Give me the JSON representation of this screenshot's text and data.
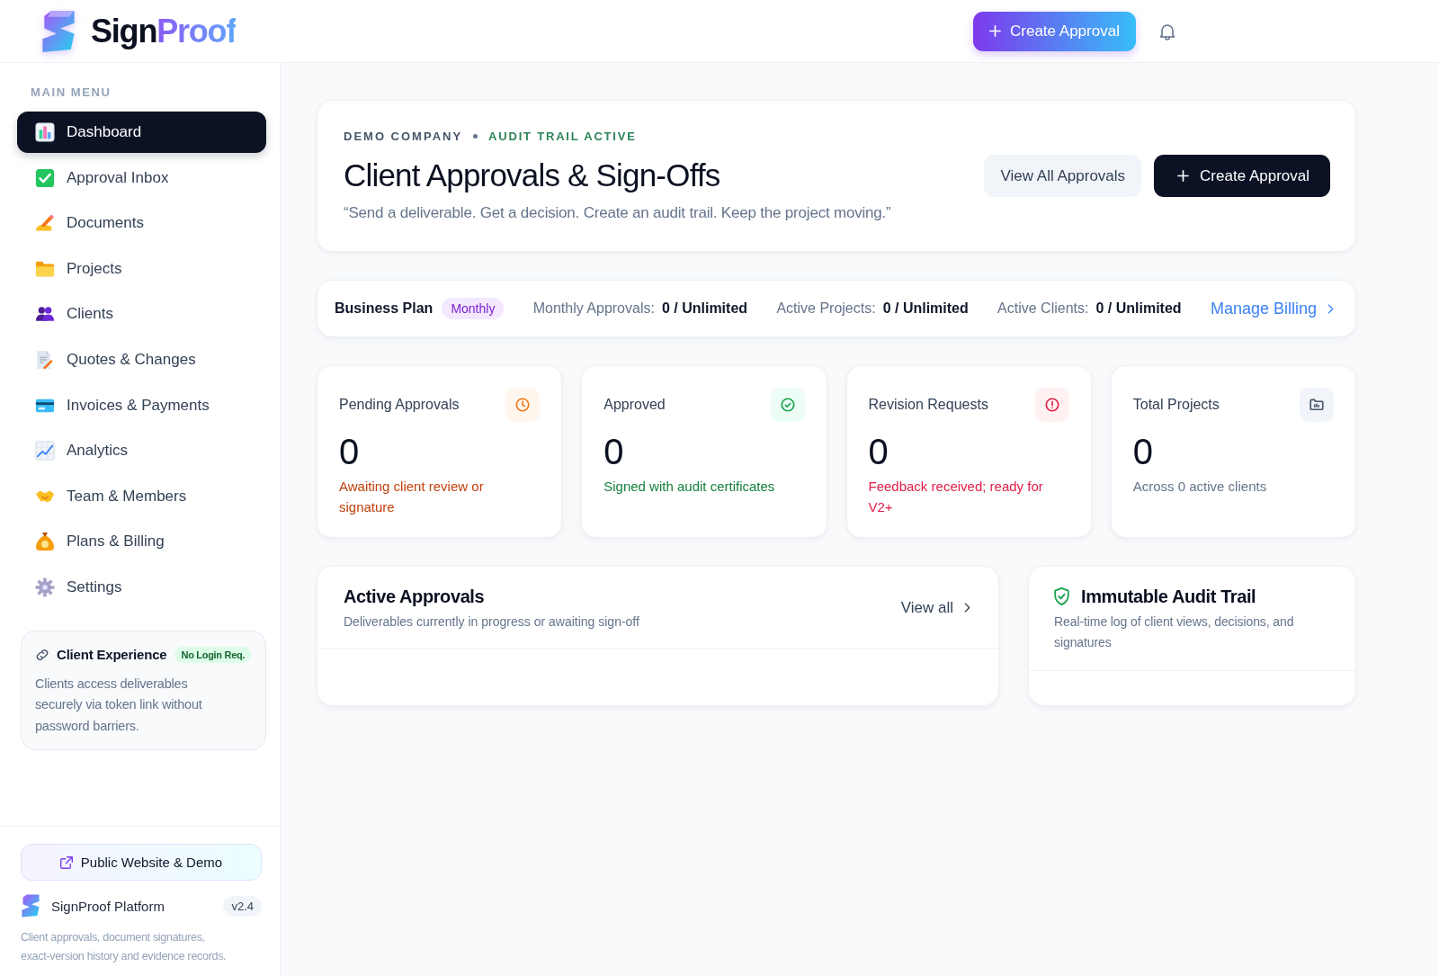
{
  "header": {
    "brand": {
      "name": "Sign",
      "accent": "Proof"
    },
    "create_button": "Create Approval"
  },
  "sidebar": {
    "section_label": "MAIN MENU",
    "items": [
      {
        "label": "Dashboard",
        "selected": true
      },
      {
        "label": "Approval Inbox",
        "selected": false
      },
      {
        "label": "Documents",
        "selected": false
      },
      {
        "label": "Projects",
        "selected": false
      },
      {
        "label": "Clients",
        "selected": false
      },
      {
        "label": "Quotes & Changes",
        "selected": false
      },
      {
        "label": "Invoices & Payments",
        "selected": false
      },
      {
        "label": "Analytics",
        "selected": false
      },
      {
        "label": "Team & Members",
        "selected": false
      },
      {
        "label": "Plans & Billing",
        "selected": false
      },
      {
        "label": "Settings",
        "selected": false
      }
    ],
    "client_card": {
      "title": "Client Experience",
      "badge": "No Login Req.",
      "text": "Clients access deliverables securely via token link without password barriers."
    },
    "footer": {
      "website_button": "Public Website & Demo",
      "platform_name": "SignProof Platform",
      "version": "v2.4",
      "description": "Client approvals, document signatures, exact-version history and evidence records."
    }
  },
  "hero": {
    "company": "DEMO COMPANY",
    "status": "AUDIT TRAIL ACTIVE",
    "title": "Client Approvals & Sign-Offs",
    "quote": "“Send a deliverable. Get a decision. Create an audit trail. Keep the project moving.”",
    "buttons": [
      {
        "label": "View All Approvals",
        "kind": "secondary"
      },
      {
        "label": "Create Approval",
        "kind": "primary"
      }
    ]
  },
  "plan_bar": {
    "plan": "Business Plan",
    "cycle": "Monthly",
    "metrics": [
      {
        "label": "Monthly Approvals:",
        "value": "0 / Unlimited"
      },
      {
        "label": "Active Projects:",
        "value": "0 / Unlimited"
      },
      {
        "label": "Active Clients:",
        "value": "0 / Unlimited"
      }
    ],
    "link": "Manage Billing"
  },
  "stats": [
    {
      "kind": "pending",
      "title": "Pending Approvals",
      "value": "0",
      "note": "Awaiting client review or signature"
    },
    {
      "kind": "approved",
      "title": "Approved",
      "value": "0",
      "note": "Signed with audit certificates"
    },
    {
      "kind": "revision",
      "title": "Revision Requests",
      "value": "0",
      "note": "Feedback received; ready for V2+"
    },
    {
      "kind": "projects",
      "title": "Total Projects",
      "value": "0",
      "note": "Across 0 active clients"
    }
  ],
  "active_approvals": {
    "title": "Active Approvals",
    "subtitle": "Deliverables currently in progress or awaiting sign-off",
    "link": "View all"
  },
  "audit_trail": {
    "title": "Immutable Audit Trail",
    "text": "Real-time log of client views, decisions, and signatures"
  }
}
